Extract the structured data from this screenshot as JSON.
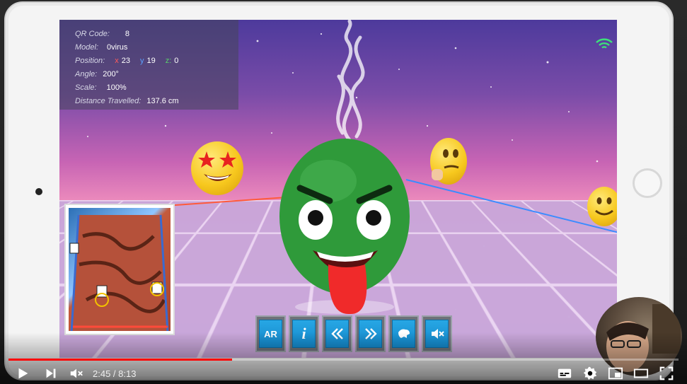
{
  "ar_info": {
    "qr_code_label": "QR Code:",
    "qr_code_value": "8",
    "model_label": "Model:",
    "model_value": "0virus",
    "position_label": "Position:",
    "position_x_axis": "x",
    "position_x": "23",
    "position_y_axis": "y",
    "position_y": "19",
    "position_z_axis": "z:",
    "position_z": "0",
    "angle_label": "Angle:",
    "angle_value": "200°",
    "scale_label": "Scale:",
    "scale_value": "100%",
    "distance_label": "Distance Travelled:",
    "distance_value": "137.6 cm"
  },
  "toolbar": {
    "ar_label": "AR",
    "info_label": "i"
  },
  "player": {
    "current_time": "2:45",
    "separator": " / ",
    "duration": "8:13",
    "progress_percent": 33.4
  },
  "colors": {
    "progress": "#ff0000",
    "toolbar_button": "#1d97d8",
    "character_green": "#2f9a3a"
  }
}
